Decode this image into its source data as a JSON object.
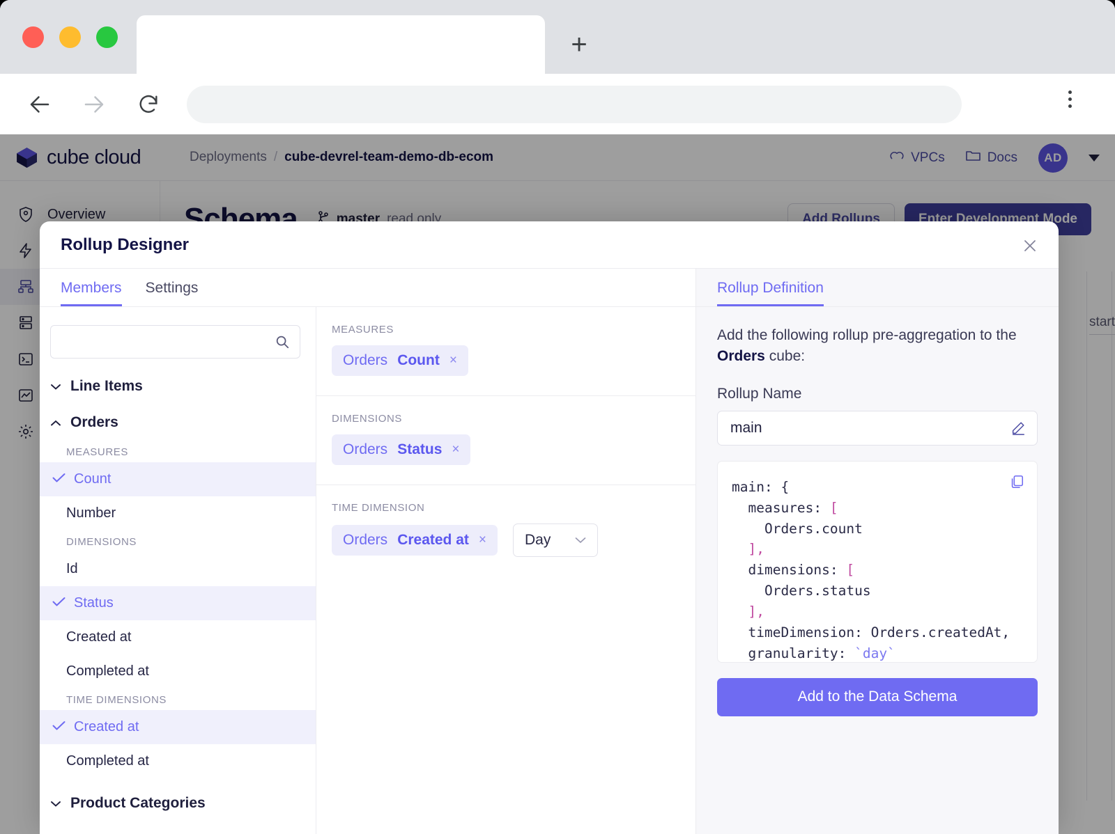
{
  "browser": {
    "tab_title": "",
    "url": "",
    "back_icon": "back-arrow-icon",
    "forward_icon": "forward-arrow-icon",
    "reload_icon": "reload-icon",
    "newtab_label": "+",
    "menu_icon": "kebab-menu-icon"
  },
  "app": {
    "logo_text": "cube cloud",
    "breadcrumb": {
      "parent": "Deployments",
      "separator": "/",
      "current": "cube-devrel-team-demo-db-ecom"
    },
    "header_links": [
      {
        "label": "VPCs",
        "icon": "cloud-icon"
      },
      {
        "label": "Docs",
        "icon": "folder-icon"
      }
    ],
    "avatar_initials": "AD",
    "sidebar": [
      {
        "label": "Overview",
        "icon": "shield-icon",
        "active": false
      },
      {
        "label": "",
        "icon": "lightning-icon",
        "active": false
      },
      {
        "label": "",
        "icon": "schema-tree-icon",
        "active": true
      },
      {
        "label": "",
        "icon": "database-icon",
        "active": false
      },
      {
        "label": "",
        "icon": "terminal-icon",
        "active": false
      },
      {
        "label": "",
        "icon": "chart-line-icon",
        "active": false
      },
      {
        "label": "",
        "icon": "gear-icon",
        "active": false
      }
    ],
    "page_title": "Schema",
    "branch": {
      "icon": "branch-icon",
      "name": "master",
      "state": "read only"
    },
    "actions": {
      "secondary": "Add Rollups",
      "primary": "Enter Development Mode"
    },
    "background_snippet": "start"
  },
  "modal": {
    "title": "Rollup Designer",
    "close_icon": "close-icon",
    "tabs": [
      {
        "label": "Members",
        "active": true
      },
      {
        "label": "Settings",
        "active": false
      }
    ],
    "search": {
      "value": "",
      "placeholder": "",
      "icon": "search-icon"
    },
    "tree": [
      {
        "type": "group",
        "label": "Line Items",
        "expanded": false,
        "chevron": "chevron-down-icon"
      },
      {
        "type": "group",
        "label": "Orders",
        "expanded": true,
        "chevron": "chevron-up-icon"
      },
      {
        "type": "section",
        "label": "MEASURES"
      },
      {
        "type": "item",
        "label": "Count",
        "selected": true
      },
      {
        "type": "item",
        "label": "Number",
        "selected": false
      },
      {
        "type": "section",
        "label": "DIMENSIONS"
      },
      {
        "type": "item",
        "label": "Id",
        "selected": false
      },
      {
        "type": "item",
        "label": "Status",
        "selected": true
      },
      {
        "type": "item",
        "label": "Created at",
        "selected": false
      },
      {
        "type": "item",
        "label": "Completed at",
        "selected": false
      },
      {
        "type": "section",
        "label": "TIME DIMENSIONS"
      },
      {
        "type": "item",
        "label": "Created at",
        "selected": true
      },
      {
        "type": "item",
        "label": "Completed at",
        "selected": false
      },
      {
        "type": "group",
        "label": "Product Categories",
        "expanded": false,
        "chevron": "chevron-down-icon"
      }
    ],
    "selection": {
      "measures": {
        "label": "MEASURES",
        "chips": [
          {
            "cube": "Orders",
            "member": "Count",
            "remove": "×"
          }
        ]
      },
      "dimensions": {
        "label": "DIMENSIONS",
        "chips": [
          {
            "cube": "Orders",
            "member": "Status",
            "remove": "×"
          }
        ]
      },
      "time_dimension": {
        "label": "TIME DIMENSION",
        "chips": [
          {
            "cube": "Orders",
            "member": "Created at",
            "remove": "×"
          }
        ],
        "granularity": {
          "value": "Day",
          "icon": "chevron-down-icon"
        }
      }
    },
    "definition": {
      "tab_label": "Rollup Definition",
      "description_pre": "Add the following rollup pre-aggregation to the ",
      "description_cube": "Orders",
      "description_post": " cube:",
      "name_label": "Rollup Name",
      "name_value": "main",
      "edit_icon": "pencil-icon",
      "copy_icon": "copy-icon",
      "code": {
        "l1": "main: {",
        "l2_key": "  measures: ",
        "l2_br": "[",
        "l3": "    Orders.count",
        "l4": "  ],",
        "l5_key": "  dimensions: ",
        "l5_br": "[",
        "l6": "    Orders.status",
        "l7": "  ],",
        "l8": "  timeDimension: Orders.createdAt,",
        "l9_key": "  granularity: ",
        "l9_val": "`day`",
        "l10": "}"
      },
      "submit_label": "Add to the Data Schema"
    }
  },
  "colors": {
    "accent": "#6f6bf2",
    "accent_dark": "#3f3f9e",
    "chip_bg": "#ededfb",
    "title": "#141446"
  }
}
